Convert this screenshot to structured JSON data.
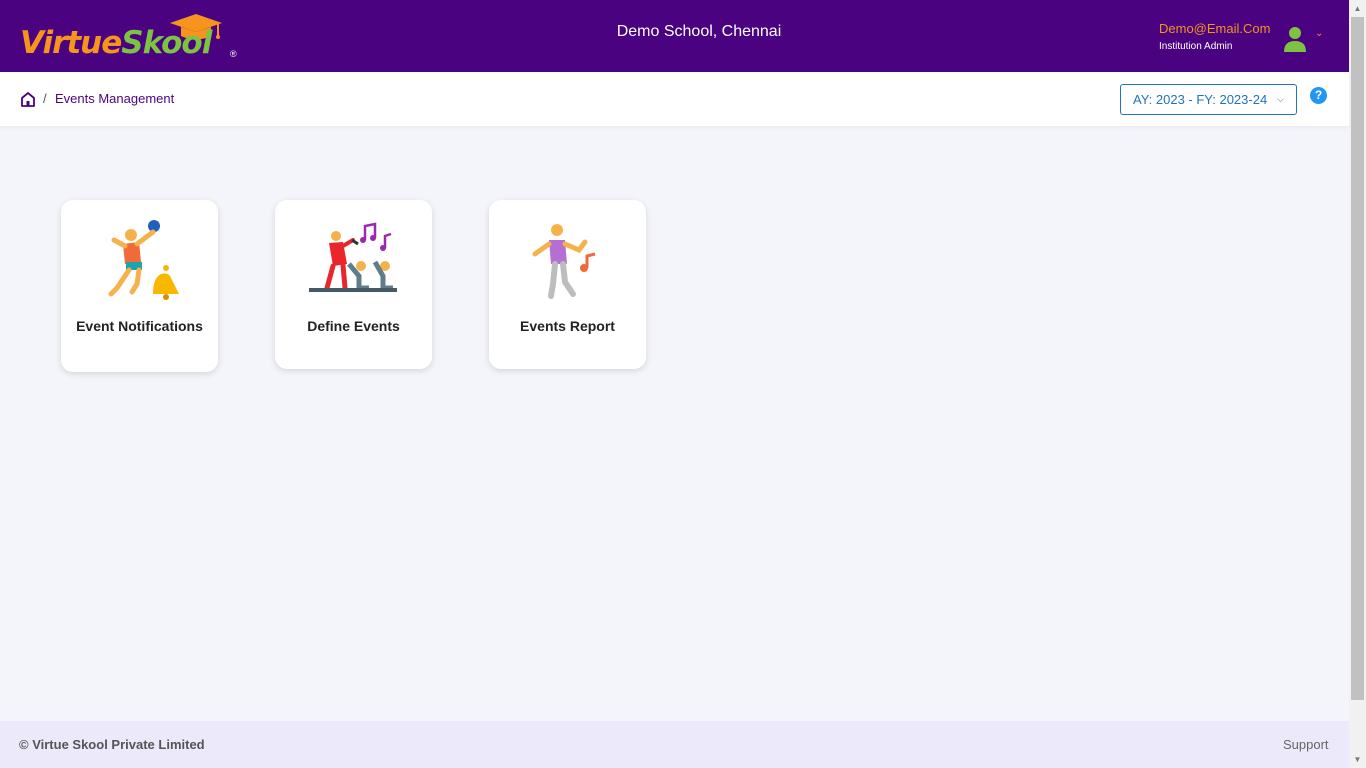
{
  "header": {
    "logo_text_part1": "Virtue",
    "logo_text_part2": "Skool",
    "logo_reg_mark": "®",
    "school_name": "Demo School, Chennai",
    "user": {
      "email": "Demo@Email.Com",
      "role": "Institution Admin",
      "avatar_icon": "user-avatar-icon",
      "dropdown_icon": "chevron-down-icon"
    }
  },
  "breadcrumb": {
    "home_icon": "home-icon",
    "separator": "/",
    "current": "Events Management"
  },
  "year_selector": {
    "value": "AY: 2023 - FY: 2023-24",
    "icon": "chevron-down-icon"
  },
  "help": {
    "label": "?"
  },
  "cards": [
    {
      "label": "Event Notifications",
      "icon": "volleyball-bell-icon"
    },
    {
      "label": "Define Events",
      "icon": "concert-singer-icon"
    },
    {
      "label": "Events Report",
      "icon": "dancer-music-icon"
    }
  ],
  "footer": {
    "copyright": "© Virtue Skool Private Limited",
    "support": "Support"
  },
  "colors": {
    "header_bg": "#4a0280",
    "brand_orange": "#f7941d",
    "brand_green": "#7dc242",
    "accent_blue": "#1f72c4",
    "page_bg": "#f4f5fa",
    "footer_bg": "#ece9fb"
  }
}
